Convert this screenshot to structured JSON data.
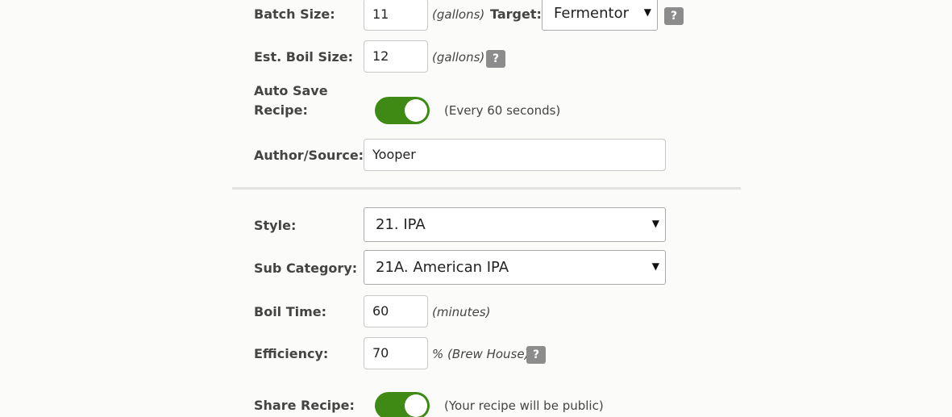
{
  "batch_size": {
    "label": "Batch Size:",
    "value": "11",
    "unit": "(gallons)",
    "target_label": "Target:",
    "target_value": "Fermentor",
    "help": "?"
  },
  "boil_size": {
    "label": "Est. Boil Size:",
    "value": "12",
    "unit": "(gallons)",
    "help": "?"
  },
  "auto_save": {
    "label_line1": "Auto Save",
    "label_line2": "Recipe:",
    "enabled": true,
    "note": "(Every 60 seconds)"
  },
  "author": {
    "label": "Author/Source:",
    "value": "Yooper"
  },
  "style": {
    "label": "Style:",
    "value": "21. IPA"
  },
  "sub_category": {
    "label": "Sub Category:",
    "value": "21A. American IPA"
  },
  "boil_time": {
    "label": "Boil Time:",
    "value": "60",
    "unit": "(minutes)"
  },
  "efficiency": {
    "label": "Efficiency:",
    "value": "70",
    "unit": "% (Brew House)",
    "help": "?"
  },
  "share": {
    "label": "Share Recipe:",
    "enabled": true,
    "note": "(Your recipe will be public)"
  },
  "colors": {
    "toggle_on": "#3e8a14",
    "help_bg": "#8c8c8c",
    "divider": "#e2e2e0"
  },
  "icons": {
    "dropdown": "caret-down-icon",
    "help": "question-icon"
  }
}
